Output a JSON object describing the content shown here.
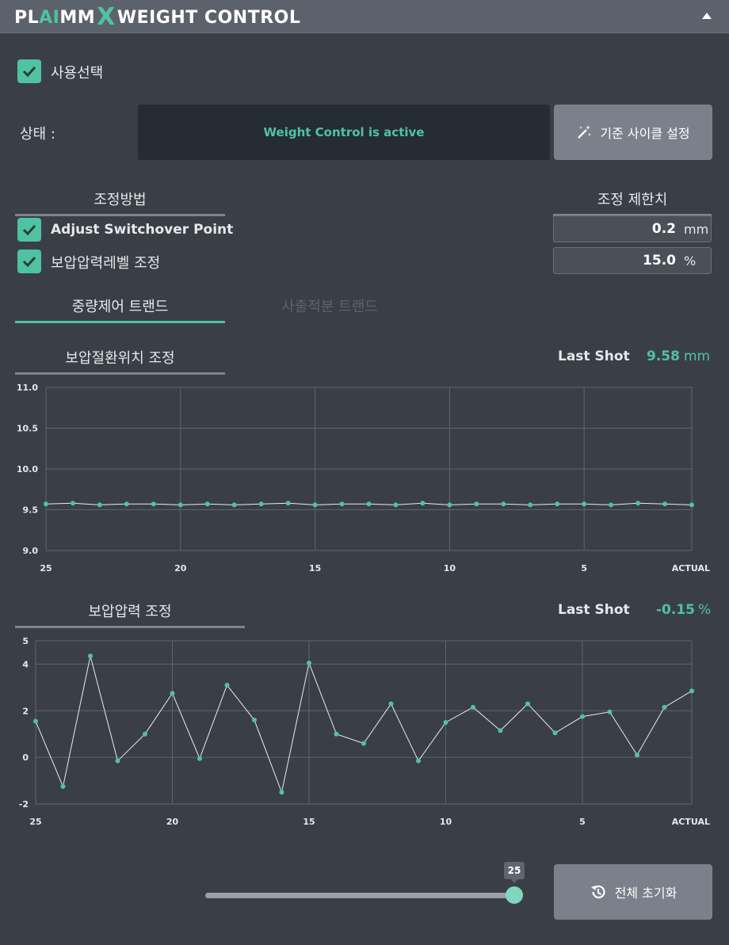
{
  "header": {
    "logo_pl": "PL",
    "logo_ai": "AI",
    "logo_mm": "MM",
    "logo_x": "X",
    "logo_rest": "WEIGHT CONTROL"
  },
  "use_select": {
    "label": "사용선택",
    "checked": true
  },
  "status": {
    "label": "상태 :",
    "message": "Weight Control is active",
    "button_label": "기준 사이클 설정"
  },
  "adjust_method": {
    "title": "조정방법",
    "options": [
      {
        "label": "Adjust Switchover Point",
        "checked": true
      },
      {
        "label": "보압압력레벨 조정",
        "checked": true
      }
    ]
  },
  "limits": {
    "title": "조정 제한치",
    "fields": [
      {
        "value": "0.2",
        "unit": "mm"
      },
      {
        "value": "15.0",
        "unit": "%"
      }
    ]
  },
  "tabs": [
    {
      "label": "중량제어 트랜드",
      "active": true
    },
    {
      "label": "사출적분 트랜드",
      "active": false
    }
  ],
  "chart1_header": {
    "title": "보압절환위치 조정",
    "last_shot_label": "Last Shot",
    "last_shot_value": "9.58",
    "last_shot_unit": "mm"
  },
  "chart2_header": {
    "title": "보압압력 조정",
    "last_shot_label": "Last Shot",
    "last_shot_value": "-0.15",
    "last_shot_unit": "%"
  },
  "chart_data": [
    {
      "type": "line",
      "x": [
        "25",
        "24",
        "23",
        "22",
        "21",
        "20",
        "19",
        "18",
        "17",
        "16",
        "15",
        "14",
        "13",
        "12",
        "11",
        "10",
        "9",
        "8",
        "7",
        "6",
        "5",
        "4",
        "3",
        "2",
        "ACTUAL"
      ],
      "x_tick_labels": [
        "25",
        "20",
        "15",
        "10",
        "5",
        "ACTUAL"
      ],
      "y_tick_labels": [
        "11.0",
        "10.5",
        "10.0",
        "9.5",
        "9.0"
      ],
      "ylim": [
        9.0,
        11.0
      ],
      "values": [
        9.57,
        9.58,
        9.56,
        9.57,
        9.57,
        9.56,
        9.57,
        9.56,
        9.57,
        9.58,
        9.56,
        9.57,
        9.57,
        9.56,
        9.58,
        9.56,
        9.57,
        9.57,
        9.56,
        9.57,
        9.57,
        9.56,
        9.58,
        9.57,
        9.56
      ],
      "grid": true,
      "color": "#4fc3a1"
    },
    {
      "type": "line",
      "x": [
        "25",
        "24",
        "23",
        "22",
        "21",
        "20",
        "19",
        "18",
        "17",
        "16",
        "15",
        "14",
        "13",
        "12",
        "11",
        "10",
        "9",
        "8",
        "7",
        "6",
        "5",
        "4",
        "3",
        "2",
        "ACTUAL"
      ],
      "x_tick_labels": [
        "25",
        "20",
        "15",
        "10",
        "5",
        "ACTUAL"
      ],
      "y_tick_labels": [
        "5",
        "4",
        "2",
        "0",
        "-2"
      ],
      "ylim": [
        -2,
        5
      ],
      "values": [
        1.55,
        -1.25,
        4.35,
        -0.15,
        1.0,
        2.75,
        -0.05,
        3.1,
        1.6,
        -1.5,
        4.05,
        1.0,
        0.6,
        2.3,
        -0.15,
        1.5,
        2.15,
        1.15,
        2.3,
        1.05,
        1.75,
        1.95,
        0.1,
        2.15,
        2.85
      ],
      "grid": true,
      "color": "#4fc3a1"
    }
  ],
  "slider": {
    "value": "25"
  },
  "reset_button": {
    "label": "전체 초기화"
  },
  "colors": {
    "accent": "#4fc3a1",
    "background": "#3a3f47",
    "header": "#5b626c"
  }
}
